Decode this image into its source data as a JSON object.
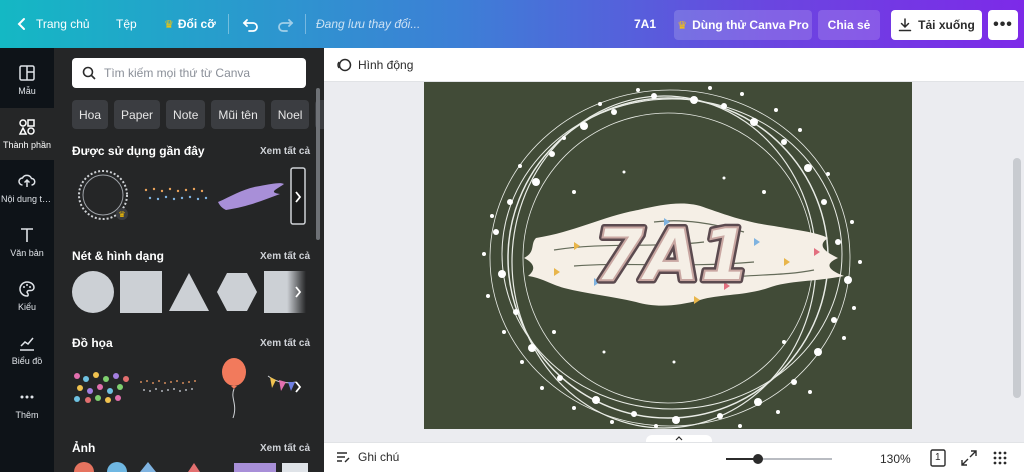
{
  "topbar": {
    "home_label": "Trang chủ",
    "file_label": "Tệp",
    "resize_label": "Đổi cỡ",
    "saving_status": "Đang lưu thay đổi...",
    "doc_title": "7A1",
    "pro_label": "Dùng thử Canva Pro",
    "share_label": "Chia sẻ",
    "download_label": "Tải xuống",
    "more_label": "•••"
  },
  "rail": {
    "items": [
      {
        "label": "Mẫu",
        "icon": "template-icon"
      },
      {
        "label": "Thành phần",
        "icon": "elements-icon"
      },
      {
        "label": "Nội dung tải lên",
        "icon": "upload-icon"
      },
      {
        "label": "Văn bản",
        "icon": "text-icon"
      },
      {
        "label": "Kiểu",
        "icon": "palette-icon"
      },
      {
        "label": "Biểu đồ",
        "icon": "chart-icon"
      },
      {
        "label": "Thêm",
        "icon": "more-icon"
      }
    ]
  },
  "panel": {
    "search_placeholder": "Tìm kiếm mọi thứ từ Canva",
    "chips": [
      "Hoa",
      "Paper",
      "Note",
      "Mũi tên",
      "Noel"
    ],
    "sections": [
      {
        "title": "Được sử dụng gần đây",
        "see_all": "Xem tất cả"
      },
      {
        "title": "Nét & hình dạng",
        "see_all": "Xem tất cả"
      },
      {
        "title": "Đồ họa",
        "see_all": "Xem tất cả"
      },
      {
        "title": "Ảnh",
        "see_all": "Xem tất cả"
      }
    ]
  },
  "canvas": {
    "animate_label": "Hình động",
    "design_text": "7A1",
    "design_bg": "#414b37"
  },
  "bottombar": {
    "notes_label": "Ghi chú",
    "zoom_level": "130%",
    "zoom_fraction": 0.3,
    "page_count": "1"
  },
  "colors": {
    "accent_start": "#14b8c4",
    "accent_end": "#7d2ae8",
    "panel_bg": "#252627",
    "rail_bg": "#0e1318"
  }
}
